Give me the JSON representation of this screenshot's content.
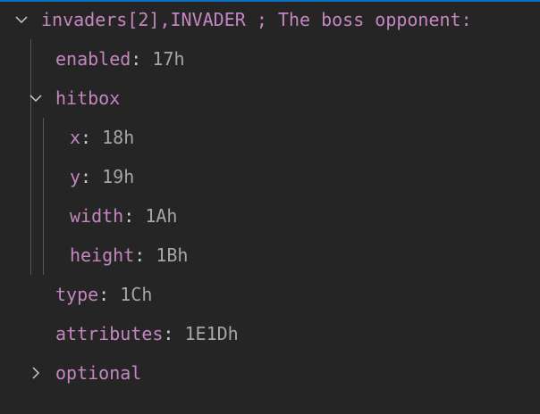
{
  "tree": {
    "root": {
      "label": "invaders[2],INVADER ; The boss opponent:",
      "expanded": true,
      "icon": "chevron-down-icon"
    },
    "enabled": {
      "key": "enabled",
      "sep": ":",
      "value": "17h"
    },
    "hitbox": {
      "key": "hitbox",
      "expanded": true,
      "icon": "chevron-down-icon",
      "children": [
        {
          "key": "x",
          "sep": ":",
          "value": "18h"
        },
        {
          "key": "y",
          "sep": ":",
          "value": "19h"
        },
        {
          "key": "width",
          "sep": ":",
          "value": "1Ah"
        },
        {
          "key": "height",
          "sep": ":",
          "value": "1Bh"
        }
      ]
    },
    "type": {
      "key": "type",
      "sep": ":",
      "value": "1Ch"
    },
    "attributes": {
      "key": "attributes",
      "sep": ":",
      "value": "1E1Dh"
    },
    "optional": {
      "key": "optional",
      "expanded": false,
      "icon": "chevron-right-icon"
    }
  },
  "colors": {
    "background": "#252526",
    "key": "#c586c0",
    "value": "#a6a6a6",
    "focus": "#0e70c0",
    "guide": "#585858"
  }
}
